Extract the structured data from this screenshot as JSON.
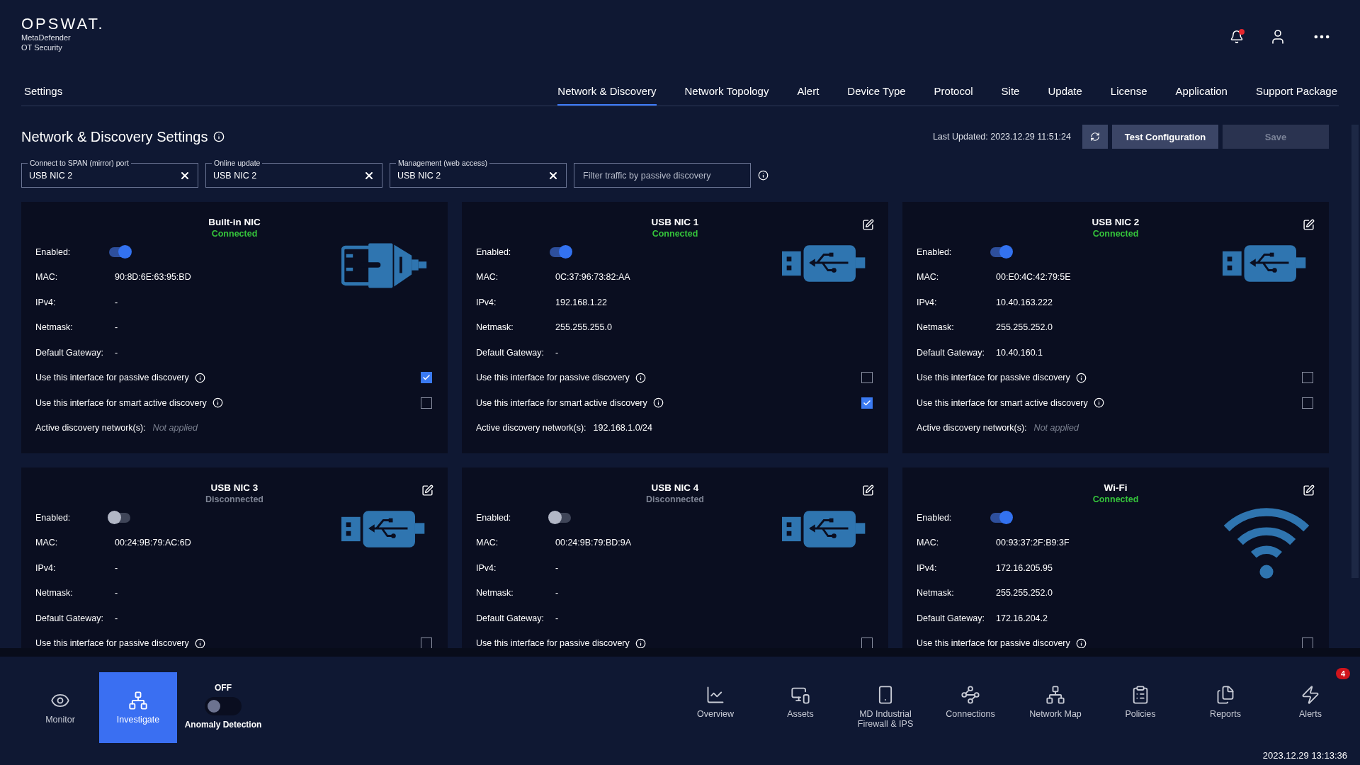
{
  "header": {
    "logo": "OPSWAT.",
    "product_lines": [
      "MetaDefender",
      "OT Security"
    ],
    "notification_unread": true
  },
  "section": "Settings",
  "tabs": [
    {
      "label": "Network & Discovery",
      "selected": true
    },
    {
      "label": "Network Topology",
      "selected": false
    },
    {
      "label": "Alert",
      "selected": false
    },
    {
      "label": "Device Type",
      "selected": false
    },
    {
      "label": "Protocol",
      "selected": false
    },
    {
      "label": "Site",
      "selected": false
    },
    {
      "label": "Update",
      "selected": false
    },
    {
      "label": "License",
      "selected": false
    },
    {
      "label": "Application",
      "selected": false
    },
    {
      "label": "Support Package",
      "selected": false
    }
  ],
  "page_title": "Network & Discovery Settings",
  "last_updated": "Last Updated: 2023.12.29 11:51:24",
  "buttons": [
    {
      "label": "Test Configuration",
      "disabled": false
    },
    {
      "label": "Save",
      "disabled": true
    }
  ],
  "port_fields": [
    {
      "legend": "Connect to SPAN (mirror) port",
      "value": "USB NIC 2"
    },
    {
      "legend": "Online update",
      "value": "USB NIC 2"
    },
    {
      "legend": "Management (web access)",
      "value": "USB NIC 2"
    }
  ],
  "filter": {
    "placeholder": "Filter traffic by passive discovery"
  },
  "interfaces": [
    {
      "name": "Built-in NIC",
      "enabled_label": "Enabled:",
      "status": "Connected",
      "connected": true,
      "enabled": true,
      "kind": "ethernet",
      "editable": false,
      "fields": [
        {
          "label": "MAC:",
          "value": "90:8D:6E:63:95:BD"
        },
        {
          "label": "IPv4:",
          "value": "-"
        },
        {
          "label": "Netmask:",
          "value": "-"
        },
        {
          "label": "Default Gateway:",
          "value": "-"
        }
      ],
      "options": [
        {
          "label": "Use this interface for passive discovery",
          "checked": true
        },
        {
          "label": "Use this interface for smart active discovery",
          "checked": false
        }
      ],
      "networks": {
        "label": "Active discovery network(s):",
        "value": "Not applied",
        "applied": false
      }
    },
    {
      "name": "USB NIC 1",
      "enabled_label": "Enabled:",
      "status": "Connected",
      "connected": true,
      "enabled": true,
      "kind": "usb",
      "editable": true,
      "fields": [
        {
          "label": "MAC:",
          "value": "0C:37:96:73:82:AA"
        },
        {
          "label": "IPv4:",
          "value": "192.168.1.22"
        },
        {
          "label": "Netmask:",
          "value": "255.255.255.0"
        },
        {
          "label": "Default Gateway:",
          "value": "-"
        }
      ],
      "options": [
        {
          "label": "Use this interface for passive discovery",
          "checked": false
        },
        {
          "label": "Use this interface for smart active discovery",
          "checked": true
        }
      ],
      "networks": {
        "label": "Active discovery network(s):",
        "value": "192.168.1.0/24",
        "applied": true
      }
    },
    {
      "name": "USB NIC 2",
      "enabled_label": "Enabled:",
      "status": "Connected",
      "connected": true,
      "enabled": true,
      "kind": "usb",
      "editable": true,
      "fields": [
        {
          "label": "MAC:",
          "value": "00:E0:4C:42:79:5E"
        },
        {
          "label": "IPv4:",
          "value": "10.40.163.222"
        },
        {
          "label": "Netmask:",
          "value": "255.255.252.0"
        },
        {
          "label": "Default Gateway:",
          "value": "10.40.160.1"
        }
      ],
      "options": [
        {
          "label": "Use this interface for passive discovery",
          "checked": false
        },
        {
          "label": "Use this interface for smart active discovery",
          "checked": false
        }
      ],
      "networks": {
        "label": "Active discovery network(s):",
        "value": "Not applied",
        "applied": false
      }
    },
    {
      "name": "USB NIC 3",
      "enabled_label": "Enabled:",
      "status": "Disconnected",
      "connected": false,
      "enabled": false,
      "kind": "usb",
      "editable": true,
      "fields": [
        {
          "label": "MAC:",
          "value": "00:24:9B:79:AC:6D"
        },
        {
          "label": "IPv4:",
          "value": "-"
        },
        {
          "label": "Netmask:",
          "value": "-"
        },
        {
          "label": "Default Gateway:",
          "value": "-"
        }
      ],
      "options": [
        {
          "label": "Use this interface for passive discovery",
          "checked": false
        }
      ]
    },
    {
      "name": "USB NIC 4",
      "enabled_label": "Enabled:",
      "status": "Disconnected",
      "connected": false,
      "enabled": false,
      "kind": "usb",
      "editable": true,
      "fields": [
        {
          "label": "MAC:",
          "value": "00:24:9B:79:BD:9A"
        },
        {
          "label": "IPv4:",
          "value": "-"
        },
        {
          "label": "Netmask:",
          "value": "-"
        },
        {
          "label": "Default Gateway:",
          "value": "-"
        }
      ],
      "options": [
        {
          "label": "Use this interface for passive discovery",
          "checked": false
        }
      ]
    },
    {
      "name": "Wi-Fi",
      "enabled_label": "Enabled:",
      "status": "Connected",
      "connected": true,
      "enabled": true,
      "kind": "wifi",
      "editable": true,
      "fields": [
        {
          "label": "MAC:",
          "value": "00:93:37:2F:B9:3F"
        },
        {
          "label": "IPv4:",
          "value": "172.16.205.95"
        },
        {
          "label": "Netmask:",
          "value": "255.255.252.0"
        },
        {
          "label": "Default Gateway:",
          "value": "172.16.204.2"
        }
      ],
      "options": [
        {
          "label": "Use this interface for passive discovery",
          "checked": false
        }
      ]
    }
  ],
  "nav_left": [
    {
      "kind": "eye",
      "label": "Monitor",
      "selected": false
    },
    {
      "kind": "tree",
      "label": "Investigate",
      "selected": true
    }
  ],
  "anomaly": {
    "state": "OFF",
    "label": "Anomaly Detection",
    "on": false
  },
  "nav_right": [
    {
      "kind": "chart",
      "label": "Overview"
    },
    {
      "kind": "assets",
      "label": "Assets"
    },
    {
      "kind": "firewall",
      "label": "MD Industrial\nFirewall & IPS"
    },
    {
      "kind": "connections",
      "label": "Connections"
    },
    {
      "kind": "tree",
      "label": "Network Map"
    },
    {
      "kind": "clipboard",
      "label": "Policies"
    },
    {
      "kind": "files",
      "label": "Reports"
    },
    {
      "kind": "zap",
      "label": "Alerts",
      "badge": "4"
    }
  ],
  "clock": "2023.12.29 13:13:36"
}
